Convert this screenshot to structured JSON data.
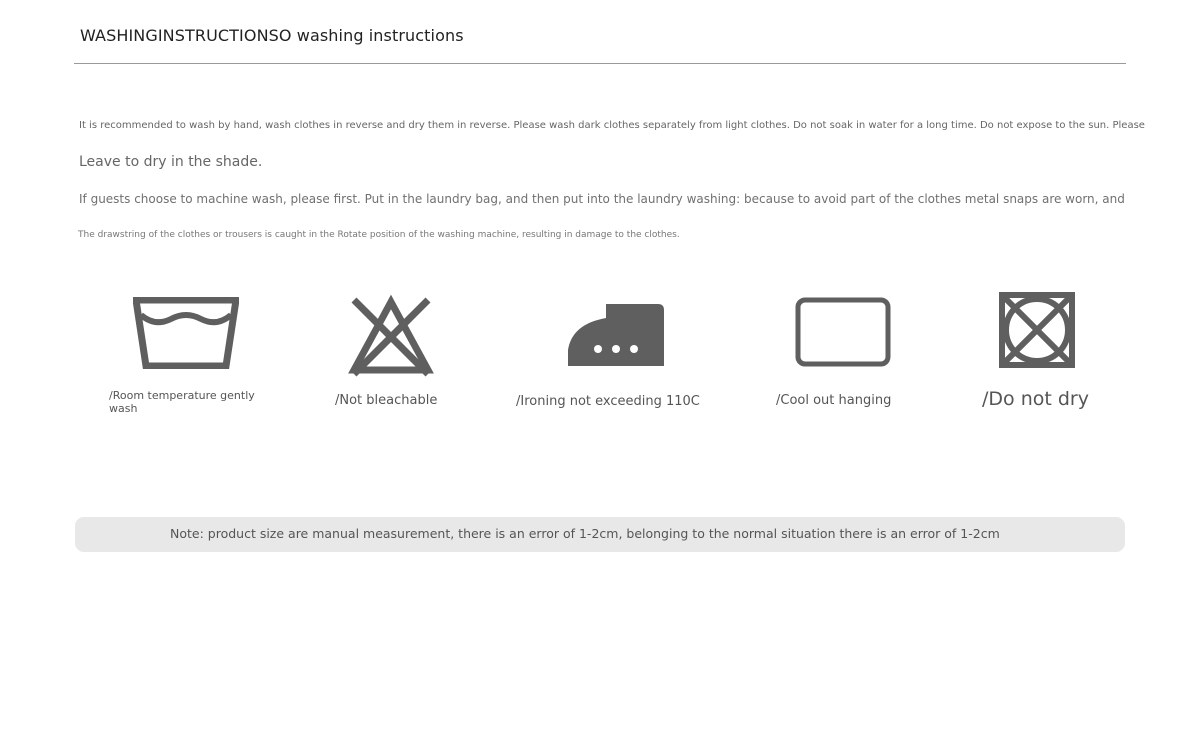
{
  "header": {
    "title": "WASHINGINSTRUCTIONSO washing instructions"
  },
  "instructions": {
    "line1": "It is recommended to wash by hand, wash clothes in reverse and dry them in reverse. Please wash dark clothes separately from light clothes. Do not soak in water for a long time. Do not expose to the sun. Please",
    "line2": "Leave to dry in the shade.",
    "line3": "If guests choose to machine wash, please first. Put in the laundry bag, and then put into the laundry washing: because to avoid part of the clothes metal snaps are worn, and",
    "line4": "The drawstring of the clothes or trousers is caught in the Rotate position of the washing machine, resulting in damage to the clothes."
  },
  "symbols": [
    {
      "icon": "wash-basin-icon",
      "label": "/Room temperature gently wash"
    },
    {
      "icon": "no-bleach-icon",
      "label": "/Not bleachable"
    },
    {
      "icon": "iron-icon",
      "label": "/Ironing not exceeding 110C"
    },
    {
      "icon": "hang-dry-icon",
      "label": "/Cool out hanging"
    },
    {
      "icon": "do-not-tumble-dry-icon",
      "label": "/Do not dry"
    }
  ],
  "colors": {
    "icon": "#5f5f5f",
    "note_background": "#e8e8e8"
  },
  "note": {
    "text": "Note: product size are manual measurement, there is an error of 1-2cm, belonging to the normal situation there is an error of 1-2cm"
  }
}
